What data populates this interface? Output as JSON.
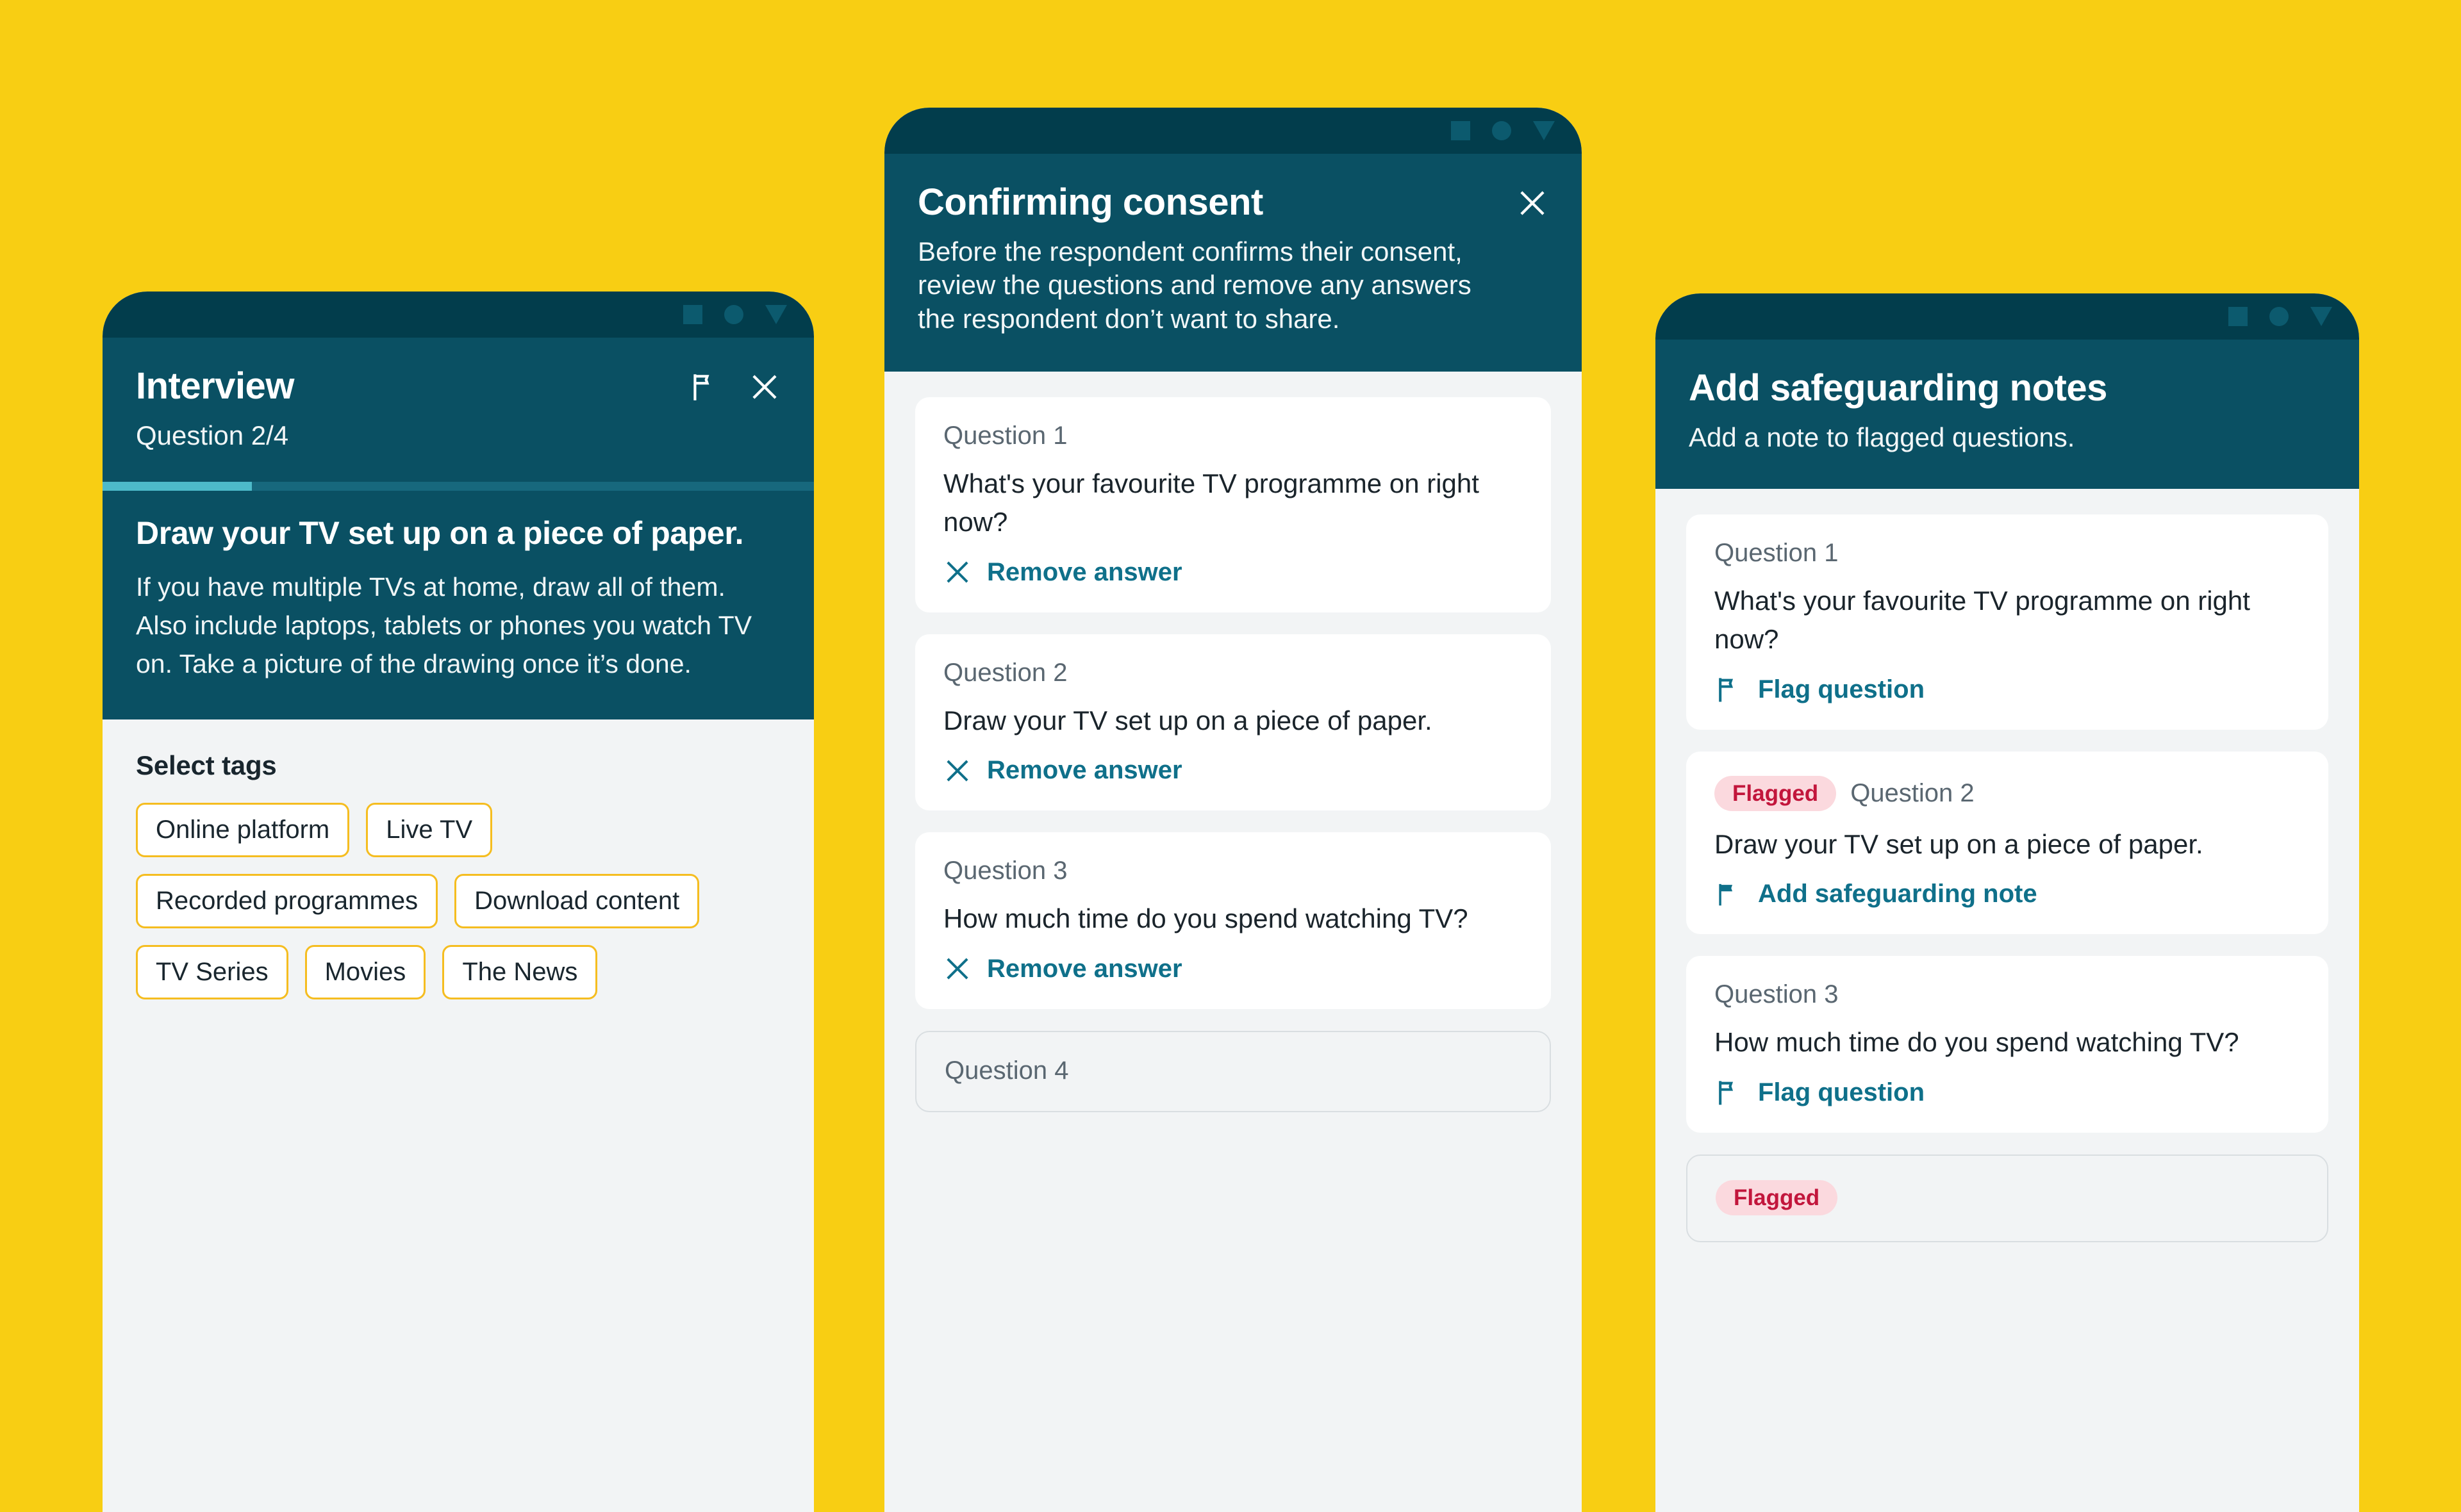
{
  "theme": {
    "background": "#F8CE13",
    "header_teal": "#0A5063",
    "status_strip": "#023D4C",
    "surface": "#F2F4F5",
    "card": "#FFFFFF",
    "accent_link": "#0F708A",
    "progress_fill": "#4DBAC9",
    "progress_track": "#17687D",
    "tag_border": "#F5BD20",
    "badge_bg": "#FBD9DE",
    "badge_text": "#C2163C"
  },
  "screens": {
    "interview": {
      "title": "Interview",
      "subtitle": "Question 2/4",
      "progress_percent": 21,
      "icons": {
        "flag": "flag-outline-icon",
        "close": "close-icon"
      },
      "question": {
        "title": "Draw your TV set up on a piece of paper.",
        "body": "If you have multiple TVs at home, draw all of them. Also include laptops, tablets or phones you watch TV on. Take a picture of the drawing once it’s done."
      },
      "tags_label": "Select tags",
      "tags": [
        "Online platform",
        "Live TV",
        "Recorded programmes",
        "Download content",
        "TV Series",
        "Movies",
        "The News"
      ]
    },
    "consent": {
      "title": "Confirming consent",
      "subtitle": "Before the respondent confirms their consent, review the questions and remove any answers the respondent don’t want to share.",
      "icons": {
        "close": "close-icon"
      },
      "cards": [
        {
          "number": "Question 1",
          "text": "What's your favourite TV programme on right now?",
          "action": "Remove answer",
          "action_icon": "close-icon",
          "badge": null,
          "ghost": false
        },
        {
          "number": "Question 2",
          "text": "Draw your TV set up on a piece of paper.",
          "action": "Remove answer",
          "action_icon": "close-icon",
          "badge": null,
          "ghost": false
        },
        {
          "number": "Question 3",
          "text": "How much time do you spend watching TV?",
          "action": "Remove answer",
          "action_icon": "close-icon",
          "badge": null,
          "ghost": false
        },
        {
          "number": "Question 4",
          "text": "",
          "action": "",
          "action_icon": "",
          "badge": null,
          "ghost": true
        }
      ]
    },
    "safeguarding": {
      "title": "Add safeguarding notes",
      "subtitle": "Add a note to flagged questions.",
      "cards": [
        {
          "number": "Question 1",
          "text": "What's your favourite TV programme on right now?",
          "action": "Flag question",
          "action_icon": "flag-outline-icon",
          "badge": null,
          "ghost": false
        },
        {
          "number": "Question 2",
          "text": "Draw your TV set up on a piece of paper.",
          "action": "Add safeguarding note",
          "action_icon": "flag-filled-icon",
          "badge": "Flagged",
          "ghost": false
        },
        {
          "number": "Question 3",
          "text": "How much time do you spend watching TV?",
          "action": "Flag question",
          "action_icon": "flag-outline-icon",
          "badge": null,
          "ghost": false
        },
        {
          "number": "",
          "text": "",
          "action": "",
          "action_icon": "",
          "badge": "Flagged",
          "ghost": true
        }
      ]
    }
  }
}
